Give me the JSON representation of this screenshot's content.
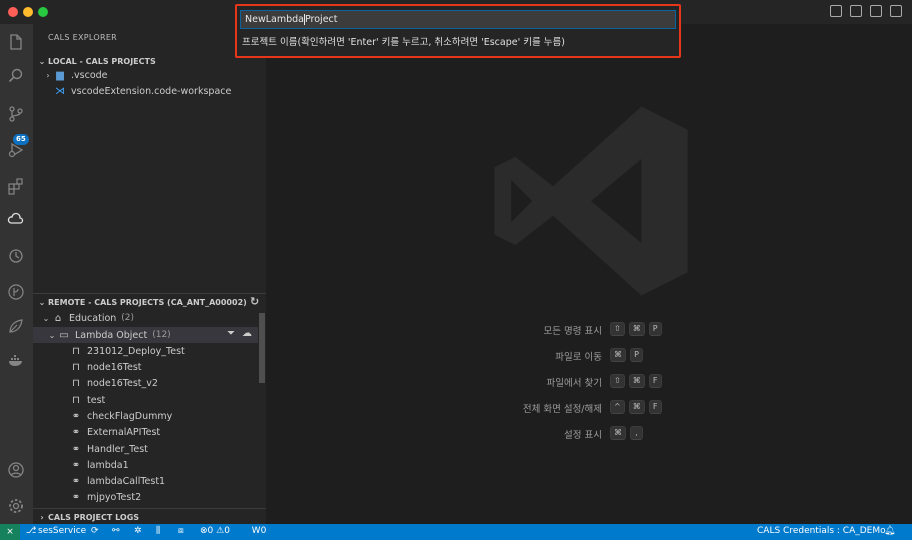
{
  "window": {
    "traffic_lights": {
      "close": "#ff5f57",
      "minimize": "#febc2e",
      "zoom": "#28c840"
    }
  },
  "activity_bar": {
    "icons": [
      "files-icon",
      "search-icon",
      "source-control-icon",
      "run-debug-icon",
      "extensions-icon",
      "cals-icon",
      "history-icon",
      "git-graph-icon",
      "leaf-icon",
      "docker-icon",
      "account-icon",
      "settings-icon"
    ],
    "scm_badge": "65"
  },
  "sidebar": {
    "title": "CALS EXPLORER",
    "local_section": {
      "header": "LOCAL - CALS PROJECTS",
      "items": [
        {
          "label": ".vscode",
          "icon": "folder-icon"
        },
        {
          "label": "vscodeExtension.code-workspace",
          "icon": "vscode-file-icon"
        }
      ]
    },
    "remote_section": {
      "header": "REMOTE - CALS PROJECTS (CA_ANT_A00002)",
      "group": {
        "label": "Education",
        "count": "(2)"
      },
      "subgroup": {
        "label": "Lambda Object",
        "count": "(12)"
      },
      "items": [
        {
          "label": "231012_Deploy_Test",
          "icon": "lock-icon"
        },
        {
          "label": "node16Test",
          "icon": "lock-icon"
        },
        {
          "label": "node16Test_v2",
          "icon": "lock-icon"
        },
        {
          "label": "test",
          "icon": "lock-icon"
        },
        {
          "label": "checkFlagDummy",
          "icon": "hierarchy-icon"
        },
        {
          "label": "ExternalAPITest",
          "icon": "hierarchy-icon"
        },
        {
          "label": "Handler_Test",
          "icon": "hierarchy-icon"
        },
        {
          "label": "lambda1",
          "icon": "hierarchy-icon"
        },
        {
          "label": "lambdaCallTest1",
          "icon": "hierarchy-icon"
        },
        {
          "label": "mjpyoTest2",
          "icon": "hierarchy-icon"
        }
      ]
    },
    "logs_section": {
      "header": "CALS PROJECT LOGS"
    }
  },
  "quick_input": {
    "value_before_cursor": "NewLambda",
    "value_after_cursor": "Project",
    "prompt": "프로젝트 이름(확인하려면 'Enter' 키를 누르고, 취소하려면 'Escape' 키를 누름)"
  },
  "editor": {
    "shortcuts": [
      {
        "label": "모든 명령 표시",
        "keys": [
          "⇧",
          "⌘",
          "P"
        ]
      },
      {
        "label": "파일로 이동",
        "keys": [
          "⌘",
          "P"
        ]
      },
      {
        "label": "파일에서 찾기",
        "keys": [
          "⇧",
          "⌘",
          "F"
        ]
      },
      {
        "label": "전체 화면 설정/해제",
        "keys": [
          "^",
          "⌘",
          "F"
        ]
      },
      {
        "label": "설정 표시",
        "keys": [
          "⌘",
          ","
        ]
      }
    ]
  },
  "status_bar": {
    "service": "sesService",
    "errors": "0",
    "warnings": "0",
    "workers": "0",
    "credentials": "CALS Credentials : CA_DEMo",
    "background": "#007acc",
    "remote_color": "#16825d"
  }
}
